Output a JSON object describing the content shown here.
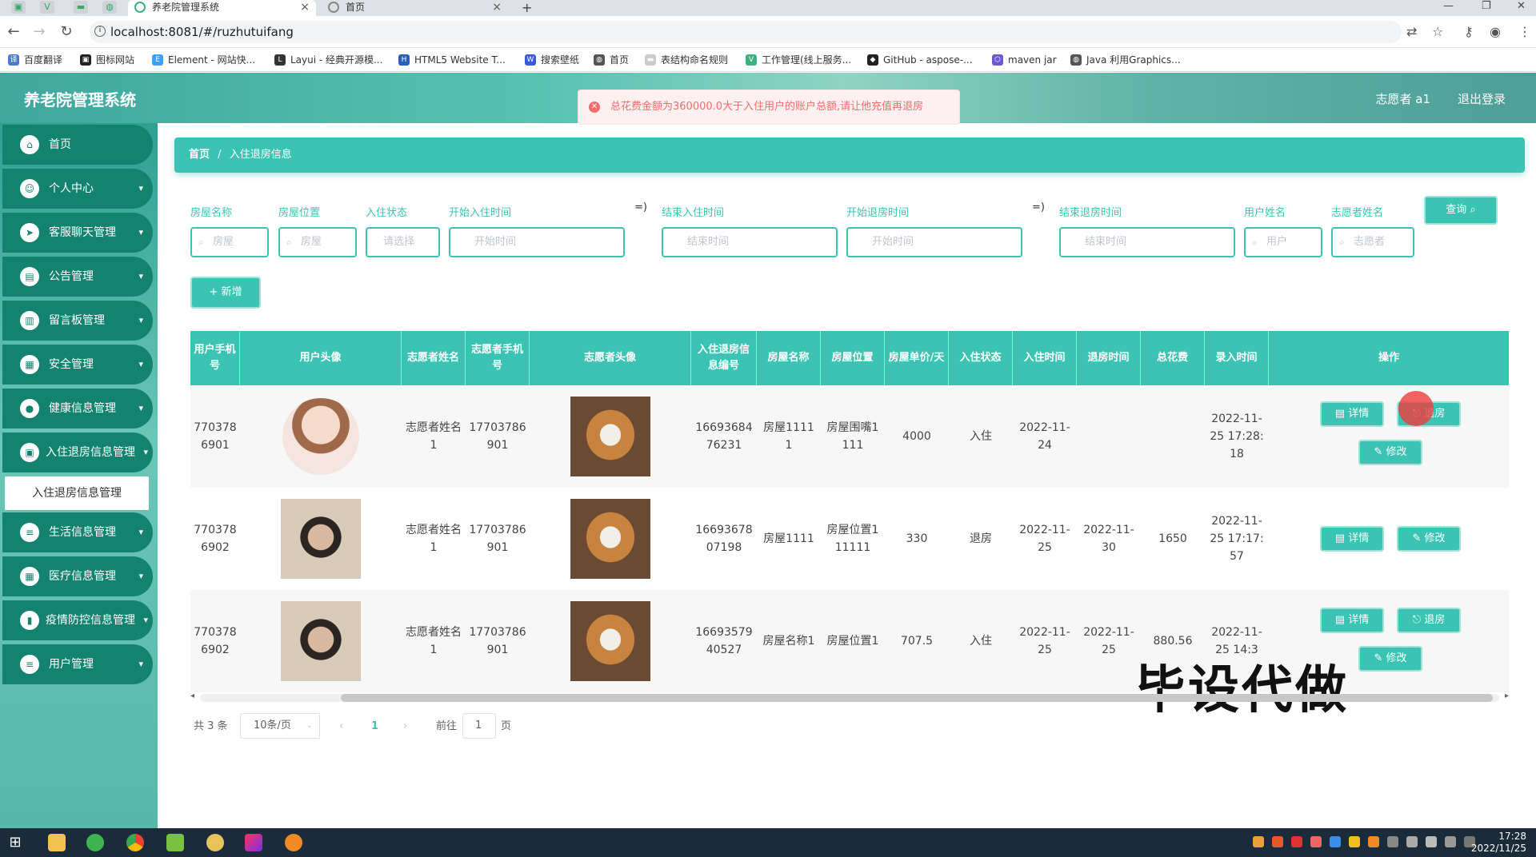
{
  "browser": {
    "tabs": [
      {
        "title": "养老院管理系统",
        "active": true
      },
      {
        "title": "首页",
        "active": false
      }
    ],
    "new_tab": "+",
    "url": "localhost:8081/#/ruzhutuifang",
    "bookmarks": [
      "百度翻译",
      "图标网站",
      "Element - 网站快...",
      "Layui - 经典开源模...",
      "HTML5 Website T...",
      "搜索壁纸",
      "首页",
      "表结构命名规则",
      "工作管理(线上服务...",
      "GitHub - aspose-...",
      "maven jar",
      "Java 利用Graphics..."
    ]
  },
  "app": {
    "title": "养老院管理系统",
    "user": "志愿者 a1",
    "logout": "退出登录",
    "toast": "总花费金额为360000.0大于入住用户的账户总额,请让他充值再退房",
    "accent": "#3bc4b3",
    "menu_dark": "#13826f"
  },
  "sidebar": {
    "items": [
      {
        "label": "首页",
        "icon": "home-icon",
        "chev": ""
      },
      {
        "label": "个人中心",
        "icon": "user-icon",
        "chev": "⌄"
      },
      {
        "label": "客服聊天管理",
        "icon": "send-icon",
        "chev": "⌄"
      },
      {
        "label": "公告管理",
        "icon": "notice-icon",
        "chev": "⌄"
      },
      {
        "label": "留言板管理",
        "icon": "message-icon",
        "chev": "⌄"
      },
      {
        "label": "安全管理",
        "icon": "grid-icon",
        "chev": "⌄"
      },
      {
        "label": "健康信息管理",
        "icon": "pin-icon",
        "chev": "⌄"
      },
      {
        "label": "入住退房信息管理",
        "icon": "bed-icon",
        "chev": "⌄"
      },
      {
        "label": "生活信息管理",
        "icon": "list-icon",
        "chev": "⌄"
      },
      {
        "label": "医疗信息管理",
        "icon": "grid-icon",
        "chev": "⌄"
      },
      {
        "label": "疫情防控信息管理",
        "icon": "book-icon",
        "chev": "⌄"
      },
      {
        "label": "用户管理",
        "icon": "list-icon",
        "chev": "⌄"
      }
    ],
    "submenu": "入住退房信息管理"
  },
  "breadcrumb": {
    "home": "首页",
    "sep": "/",
    "current": "入住退房信息"
  },
  "filters": {
    "labels": [
      "房屋名称",
      "房屋位置",
      "入住状态",
      "开始入住时间",
      "结束入住时间",
      "开始退房时间",
      "结束退房时间",
      "用户姓名",
      "志愿者姓名"
    ],
    "placeholders": [
      "房屋",
      "房屋",
      "请选择",
      "开始时间",
      "结束时间",
      "开始时间",
      "结束时间",
      "用户",
      "志愿者"
    ],
    "range_sep": "=)",
    "search": "查询",
    "add": "+ 新增"
  },
  "table": {
    "headers": [
      "用户手机号",
      "用户头像",
      "志愿者姓名",
      "志愿者手机号",
      "志愿者头像",
      "入住退房信息编号",
      "房屋名称",
      "房屋位置",
      "房屋单价/天",
      "入住状态",
      "入住时间",
      "退房时间",
      "总花费",
      "录入时间",
      "操作"
    ],
    "rows": [
      {
        "phone": "7703786901",
        "vname": "志愿者姓名1",
        "vphone": "17703786901",
        "code": "1669368476231",
        "house": "房屋11111",
        "loc": "房屋围嘴1111",
        "price": "4000",
        "status": "入住",
        "in": "2022-11-24",
        "out": "",
        "cost": "",
        "created": "2022-11-25 17:28:18",
        "avatar": "girl"
      },
      {
        "phone": "7703786902",
        "vname": "志愿者姓名1",
        "vphone": "17703786901",
        "code": "1669367807198",
        "house": "房屋1111",
        "loc": "房屋位置111111",
        "price": "330",
        "status": "退房",
        "in": "2022-11-25",
        "out": "2022-11-30",
        "cost": "1650",
        "created": "2022-11-25 17:17:57",
        "avatar": "boy"
      },
      {
        "phone": "7703786902",
        "vname": "志愿者姓名1",
        "vphone": "17703786901",
        "code": "1669357940527",
        "house": "房屋名称1",
        "loc": "房屋位置1",
        "price": "707.5",
        "status": "入住",
        "in": "2022-11-25",
        "out": "2022-11-25",
        "cost": "880.56",
        "created": "2022-11-25 14:3",
        "avatar": "boy"
      }
    ],
    "actions": {
      "detail": "详情",
      "checkout": "退房",
      "edit": "修改"
    }
  },
  "pagination": {
    "total": "共 3 条",
    "size": "10条/页",
    "prev": "‹",
    "page": "1",
    "next": "›",
    "goto": "前往",
    "goto_val": "1",
    "unit": "页"
  },
  "watermark": "毕设代做",
  "clock": {
    "time": "17:28",
    "date": "2022/11/25"
  }
}
